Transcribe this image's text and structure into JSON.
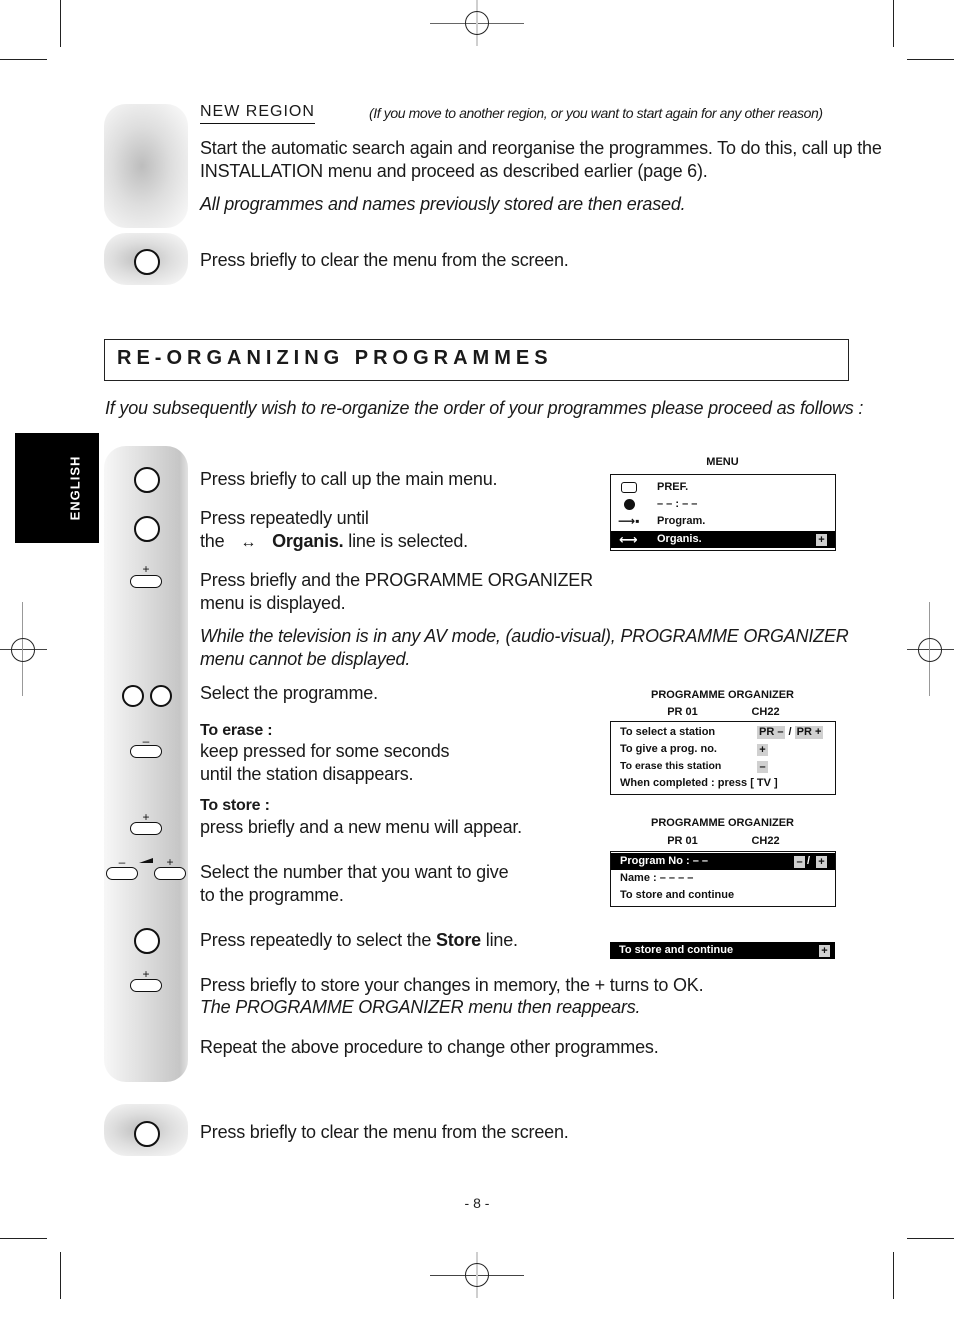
{
  "language_tab": "ENGLISH",
  "new_region": {
    "title": "NEW REGION",
    "note": "(If you move to another region, or you want to start again for any other reason)",
    "body_line1": "Start the automatic search again and reorganise the programmes. To do this, call up the",
    "body_line2": "INSTALLATION menu and proceed as described earlier (page 6).",
    "italic_note": "All programmes and names previously stored are then erased.",
    "clear_instruction": "Press briefly to clear the menu from the screen."
  },
  "section": {
    "heading": "RE-ORGANIZING PROGRAMMES",
    "intro": "If you subsequently wish to re-organize the order of your programmes please proceed as follows :"
  },
  "steps": {
    "s1": "Press briefly to call up the main menu.",
    "s2_line1": "Press repeatedly until",
    "s2_line2_pre": "the",
    "s2_line2_bold": "Organis.",
    "s2_line2_post": "line is selected.",
    "s3_line1": "Press briefly and the PROGRAMME ORGANIZER",
    "s3_line2": "menu is displayed.",
    "s3_note1": "While the television is in any AV mode, (audio-visual), PROGRAMME ORGANIZER",
    "s3_note2": "menu cannot be displayed.",
    "s4": "Select the programme.",
    "erase_title": "To erase :",
    "erase_line1": "keep pressed for some seconds",
    "erase_line2": "until the station disappears.",
    "store_title": "To store :",
    "store_line1": "press briefly and a new menu will appear.",
    "number_line1": "Select the number that you want to give",
    "number_line2": "to the programme.",
    "select_store_pre": "Press repeatedly to select the",
    "select_store_bold": "Store",
    "select_store_post": "line.",
    "store_changes": "Press briefly to store your changes in memory, the + turns to OK.",
    "reappears": "The PROGRAMME ORGANIZER menu then reappears.",
    "repeat": "Repeat the above procedure to change other programmes.",
    "clear_instruction": "Press briefly to clear the menu from the screen."
  },
  "keys": {
    "plus": "+",
    "minus": "–"
  },
  "menu_osd": {
    "title": "MENU",
    "items": [
      {
        "icon": "tv-screen-icon",
        "label": "PREF."
      },
      {
        "icon": "clock-icon",
        "label": "– – : – –"
      },
      {
        "icon": "arrow-to-block-icon",
        "label": "Program."
      },
      {
        "icon": "double-arrow-icon",
        "label": "Organis.",
        "selected": true,
        "badge": "+"
      }
    ]
  },
  "organizer_osd_1": {
    "title": "PROGRAMME ORGANIZER",
    "pr": "PR 01",
    "ch": "CH22",
    "rows": [
      {
        "label": "To select a station",
        "action_a": "PR –",
        "separator": "/",
        "action_b": "PR +"
      },
      {
        "label": "To give a prog. no.",
        "action_a": "+"
      },
      {
        "label": "To erase this station",
        "action_a": "–"
      },
      {
        "label": "When completed : press [ TV ]"
      }
    ]
  },
  "organizer_osd_2": {
    "title": "PROGRAMME ORGANIZER",
    "pr": "PR 01",
    "ch": "CH22",
    "rows": [
      {
        "label": "Program No : – –",
        "selected": true,
        "minus": "–",
        "separator": "/",
        "plus": "+"
      },
      {
        "label": "Name : – – – –"
      },
      {
        "label": "To store and continue"
      }
    ]
  },
  "store_bar": {
    "label": "To store and continue",
    "badge": "+"
  },
  "page_number": "- 8 -"
}
